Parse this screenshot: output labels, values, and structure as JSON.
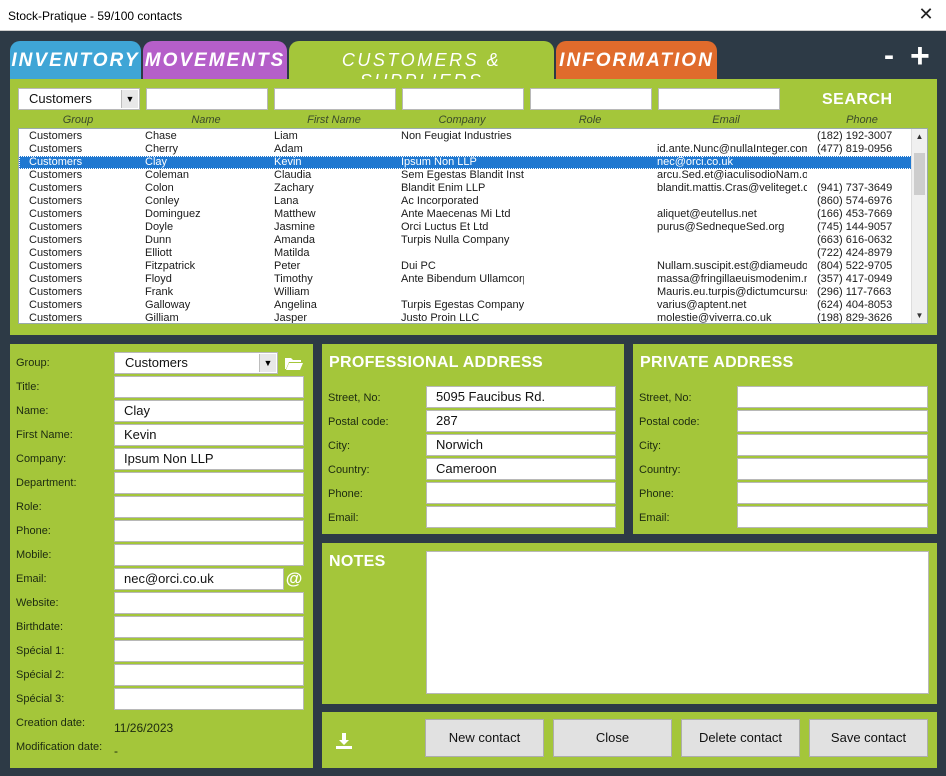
{
  "window": {
    "title": "Stock-Pratique - 59/100 contacts",
    "close_glyph": "✕"
  },
  "tabs": [
    {
      "label": "INVENTORY",
      "color": "#3fa5d6"
    },
    {
      "label": "MOVEMENTS",
      "color": "#b55fc9"
    },
    {
      "label": "CUSTOMERS & SUPPLIERS",
      "color": "#a4c63a"
    },
    {
      "label": "INFORMATION",
      "color": "#e06b2c"
    }
  ],
  "controls": {
    "minus": "-",
    "plus": "+"
  },
  "search": {
    "group_value": "Customers",
    "button_label": "SEARCH",
    "columns": [
      "Group",
      "Name",
      "First Name",
      "Company",
      "Role",
      "Email",
      "Phone"
    ]
  },
  "contacts": [
    {
      "group": "Customers",
      "name": "Chase",
      "first": "Liam",
      "company": "Non Feugiat Industries",
      "role": "",
      "email": "",
      "phone": "(182) 192-3007"
    },
    {
      "group": "Customers",
      "name": "Cherry",
      "first": "Adam",
      "company": "",
      "role": "",
      "email": "id.ante.Nunc@nullaInteger.com",
      "phone": "(477) 819-0956"
    },
    {
      "group": "Customers",
      "name": "Clay",
      "first": "Kevin",
      "company": "Ipsum Non LLP",
      "role": "",
      "email": "nec@orci.co.uk",
      "phone": ""
    },
    {
      "group": "Customers",
      "name": "Coleman",
      "first": "Claudia",
      "company": "Sem Egestas Blandit Insti",
      "role": "",
      "email": "arcu.Sed.et@iaculisodioNam.or",
      "phone": ""
    },
    {
      "group": "Customers",
      "name": "Colon",
      "first": "Zachary",
      "company": "Blandit Enim LLP",
      "role": "",
      "email": "blandit.mattis.Cras@veliteget.c",
      "phone": "(941) 737-3649"
    },
    {
      "group": "Customers",
      "name": "Conley",
      "first": "Lana",
      "company": "Ac Incorporated",
      "role": "",
      "email": "",
      "phone": "(860) 574-6976"
    },
    {
      "group": "Customers",
      "name": "Dominguez",
      "first": "Matthew",
      "company": "Ante Maecenas Mi Ltd",
      "role": "",
      "email": "aliquet@eutellus.net",
      "phone": "(166) 453-7669"
    },
    {
      "group": "Customers",
      "name": "Doyle",
      "first": "Jasmine",
      "company": "Orci Luctus Et Ltd",
      "role": "",
      "email": "purus@SednequeSed.org",
      "phone": "(745) 144-9057"
    },
    {
      "group": "Customers",
      "name": "Dunn",
      "first": "Amanda",
      "company": "Turpis Nulla Company",
      "role": "",
      "email": "",
      "phone": "(663) 616-0632"
    },
    {
      "group": "Customers",
      "name": "Elliott",
      "first": "Matilda",
      "company": "",
      "role": "",
      "email": "",
      "phone": "(722) 424-8979"
    },
    {
      "group": "Customers",
      "name": "Fitzpatrick",
      "first": "Peter",
      "company": "Dui PC",
      "role": "",
      "email": "Nullam.suscipit.est@diameudolo",
      "phone": "(804) 522-9705"
    },
    {
      "group": "Customers",
      "name": "Floyd",
      "first": "Timothy",
      "company": "Ante Bibendum Ullamcorp",
      "role": "",
      "email": "massa@fringillaeuismodenim.ne",
      "phone": "(357) 417-0949"
    },
    {
      "group": "Customers",
      "name": "Frank",
      "first": "William",
      "company": "",
      "role": "",
      "email": "Mauris.eu.turpis@dictumcursus",
      "phone": "(296) 117-7663"
    },
    {
      "group": "Customers",
      "name": "Galloway",
      "first": "Angelina",
      "company": "Turpis Egestas Company",
      "role": "",
      "email": "varius@aptent.net",
      "phone": "(624) 404-8053"
    },
    {
      "group": "Customers",
      "name": "Gilliam",
      "first": "Jasper",
      "company": "Justo Proin LLC",
      "role": "",
      "email": "molestie@viverra.co.uk",
      "phone": "(198) 829-3626"
    }
  ],
  "selected_index": 2,
  "form": {
    "labels": [
      "Group:",
      "Title:",
      "Name:",
      "First Name:",
      "Company:",
      "Department:",
      "Role:",
      "Phone:",
      "Mobile:",
      "Email:",
      "Website:",
      "Birthdate:",
      "Spécial 1:",
      "Spécial 2:",
      "Spécial 3:",
      "Creation date:",
      "Modification date:"
    ],
    "group": "Customers",
    "title": "",
    "name": "Clay",
    "first_name": "Kevin",
    "company": "Ipsum Non LLP",
    "department": "",
    "role": "",
    "phone": "",
    "mobile": "",
    "email": "nec@orci.co.uk",
    "website": "",
    "birthdate": "",
    "special1": "",
    "special2": "",
    "special3": "",
    "creation_date": "11/26/2023",
    "modification_date": "-",
    "at_glyph": "@"
  },
  "professional": {
    "title": "PROFESSIONAL ADDRESS",
    "labels": [
      "Street, No:",
      "Postal code:",
      "City:",
      "Country:",
      "Phone:",
      "Email:"
    ],
    "values": [
      "5095 Faucibus Rd.",
      "287",
      "Norwich",
      "Cameroon",
      "",
      ""
    ]
  },
  "private": {
    "title": "PRIVATE ADDRESS",
    "labels": [
      "Street, No:",
      "Postal code:",
      "City:",
      "Country:",
      "Phone:",
      "Email:"
    ],
    "values": [
      "",
      "",
      "",
      "",
      "",
      ""
    ]
  },
  "notes": {
    "title": "NOTES",
    "value": ""
  },
  "buttons": {
    "new": "New contact",
    "close": "Close",
    "delete": "Delete contact",
    "save": "Save contact"
  }
}
